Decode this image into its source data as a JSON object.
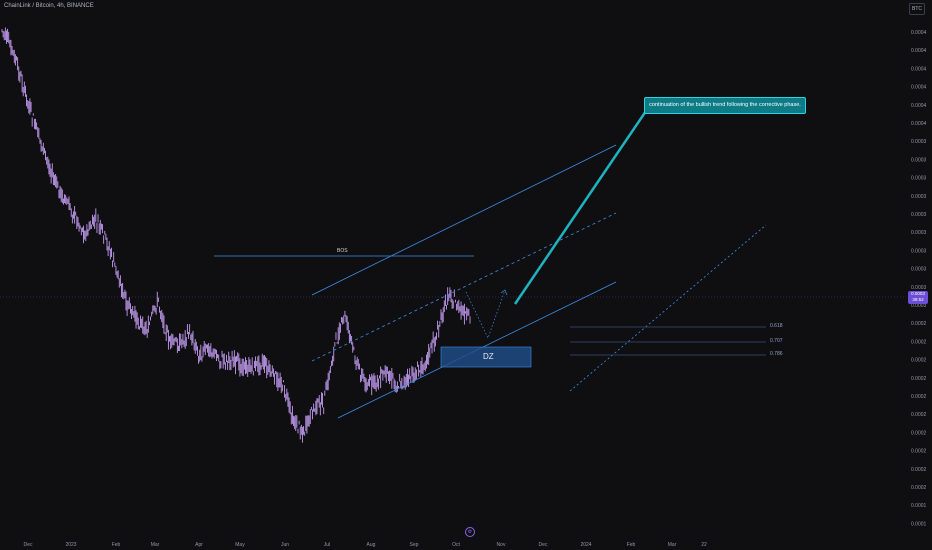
{
  "header": {
    "symbol": "ChainLink / Bitcoin, 4h, BINANCE",
    "currency_button": "BTC"
  },
  "price_tag": {
    "price": "0.0003",
    "countdown": "39:52"
  },
  "annotation": {
    "text": "continuation of the bullish trend following the corrective phase."
  },
  "labels": {
    "bos": "BOS",
    "dz": "DZ"
  },
  "fib_levels": [
    "0.618",
    "0.707",
    "0.786"
  ],
  "colors": {
    "background": "#0f0f12",
    "candles": "#c29bf0",
    "trend_lines": "#3b8fe6",
    "demand_zone": "#1f4e8c",
    "annotation": "#0d7c86",
    "price_tag": "#6c4fd6"
  },
  "icons": {
    "bottom": "gear-icon"
  },
  "chart_data": {
    "type": "line",
    "title": "",
    "x": [
      "Dec",
      "2023",
      "Feb",
      "Mar",
      "Apr",
      "May",
      "Jun",
      "Jul",
      "Aug",
      "Sep",
      "Oct",
      "Nov",
      "Dec",
      "2024",
      "Feb",
      "Mar",
      "22"
    ],
    "y_ticks": [
      "0.0004",
      "0.0004",
      "0.0004",
      "0.0004",
      "0.0004",
      "0.0004",
      "0.0003",
      "0.0003",
      "0.0003",
      "0.0003",
      "0.0003",
      "0.0003",
      "0.0003",
      "0.0003",
      "0.0003",
      "0.0003",
      "0.0002",
      "0.0002",
      "0.0002",
      "0.0002",
      "0.0002",
      "0.0002",
      "0.0002",
      "0.0002",
      "0.0002",
      "0.0002",
      "0.0001",
      "0.0001"
    ],
    "series": [
      {
        "values": [
          0.00045,
          0.00043,
          0.000395,
          0.00036,
          0.00033,
          0.0003,
          0.00028,
          0.000265,
          0.000245,
          0.00026,
          0.00024,
          0.00021,
          0.000175,
          0.00016,
          0.00015,
          0.00018,
          0.00014,
          0.000135,
          0.000148,
          0.000125,
          0.000132,
          0.00012,
          0.00012,
          0.000115,
          0.000112,
          0.000118,
          0.000105,
          9.5e-05,
          6e-05,
          4.8e-05,
          7.2e-05,
          7.8e-05,
          0.000135,
          0.000165,
          0.00012,
          9.5e-05,
          9.8e-05,
          0.000108,
          9.5e-05,
          0.0001,
          0.000108,
          0.000125,
          0.000152,
          0.000188,
          0.00017,
          0.00016
        ]
      }
    ]
  }
}
